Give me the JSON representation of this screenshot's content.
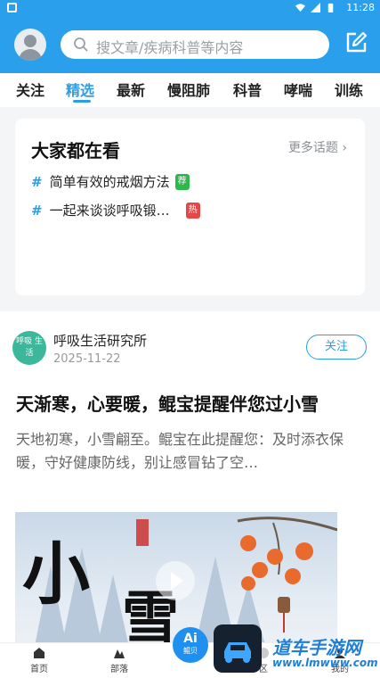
{
  "status_bar": {
    "time": "11:28"
  },
  "search": {
    "placeholder": "搜文章/疾病科普等内容"
  },
  "tabs": [
    {
      "label": "关注",
      "active": false
    },
    {
      "label": "精选",
      "active": true
    },
    {
      "label": "最新",
      "active": false
    },
    {
      "label": "慢阻肺",
      "active": false
    },
    {
      "label": "科普",
      "active": false
    },
    {
      "label": "哮喘",
      "active": false
    },
    {
      "label": "训练",
      "active": false
    }
  ],
  "trending": {
    "title": "大家都在看",
    "more_label": "更多话题 ›",
    "topics": [
      {
        "text": "简单有效的戒烟方法",
        "tag": "荐",
        "tag_color": "#2cb84a"
      },
      {
        "text": "一起来谈谈呼吸锻…",
        "tag": "热",
        "tag_color": "#e54646"
      }
    ]
  },
  "post": {
    "author_logo_text": "呼吸 生活",
    "author": "呼吸生活研究所",
    "date": "2025-11-22",
    "follow_label": "关注",
    "title": "天渐寒，心要暖，鲲宝提醒伴您过小雪",
    "summary": "天地初寒，小雪翩至。鲲宝在此提醒您：及时添衣保暖，守好健康防线，别让感冒钻了空…",
    "image_chars": [
      "小",
      "雪"
    ]
  },
  "bottom_nav": [
    {
      "label": "首页",
      "icon": "home-icon"
    },
    {
      "label": "部落",
      "icon": "tribe-icon"
    },
    {
      "label": "区",
      "icon": "community-icon"
    },
    {
      "label": "我的",
      "icon": "profile-icon"
    }
  ],
  "ai_fab": {
    "label": "Ai",
    "sub": "鲲贝"
  },
  "watermark": {
    "text": "道车手游网",
    "url": "www.lmwww.com"
  },
  "colors": {
    "brand": "#2aa0ec",
    "accent": "#2a9fe8"
  }
}
